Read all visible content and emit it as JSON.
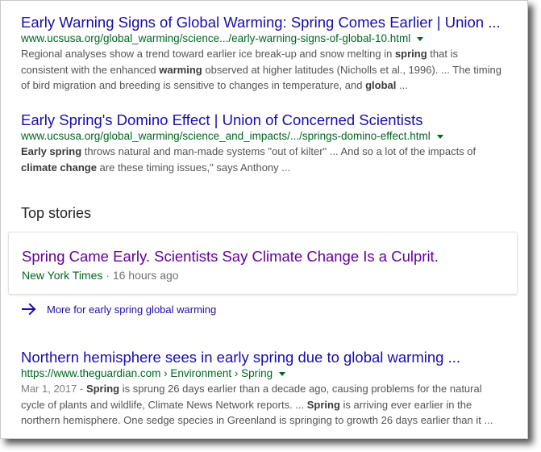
{
  "results": [
    {
      "title": "Early Warning Signs of Global Warming: Spring Comes Earlier | Union ...",
      "url": "www.ucsusa.org/global_warming/science.../early-warning-signs-of-global-10.html",
      "snippet_parts": [
        {
          "t": "Regional analyses show a trend toward earlier ice break-up and snow melting in ",
          "b": false
        },
        {
          "t": "spring",
          "b": true
        },
        {
          "t": " that is consistent with the enhanced ",
          "b": false
        },
        {
          "t": "warming",
          "b": true
        },
        {
          "t": " observed at higher latitudes (Nicholls et al., 1996). ... The timing of bird migration and breeding is sensitive to changes in temperature, and ",
          "b": false
        },
        {
          "t": "global",
          "b": true
        },
        {
          "t": " ...",
          "b": false
        }
      ]
    },
    {
      "title": "Early Spring's Domino Effect | Union of Concerned Scientists",
      "url": "www.ucsusa.org/global_warming/science_and_impacts/.../springs-domino-effect.html",
      "snippet_parts": [
        {
          "t": "Early spring",
          "b": true
        },
        {
          "t": " throws natural and man-made systems \"out of kilter\" ... And so a lot of the impacts of ",
          "b": false
        },
        {
          "t": "climate change",
          "b": true
        },
        {
          "t": " are these timing issues,\" says Anthony ...",
          "b": false
        }
      ]
    },
    {
      "title": "Northern hemisphere sees in early spring due to global warming ...",
      "url": "https://www.theguardian.com › Environment › Spring",
      "date": "Mar 1, 2017 - ",
      "snippet_parts": [
        {
          "t": "Spring",
          "b": true
        },
        {
          "t": " is sprung 26 days earlier than a decade ago, causing problems for the natural cycle of plants and wildlife, Climate News Network reports. ... ",
          "b": false
        },
        {
          "t": "Spring",
          "b": true
        },
        {
          "t": " is arriving ever earlier in the northern hemisphere. One sedge species in Greenland is springing to growth 26 days earlier than it ...",
          "b": false
        }
      ]
    }
  ],
  "top_stories": {
    "heading": "Top stories",
    "story": {
      "title": "Spring Came Early. Scientists Say Climate Change Is a Culprit.",
      "source": "New York Times",
      "separator": " · ",
      "time": "16 hours ago"
    },
    "more_link": "More for early spring global warming",
    "more_icon": "arrow-right-icon"
  },
  "colors": {
    "link": "#1a0dab",
    "visited": "#660099",
    "url": "#006621",
    "snippet": "#545454"
  }
}
